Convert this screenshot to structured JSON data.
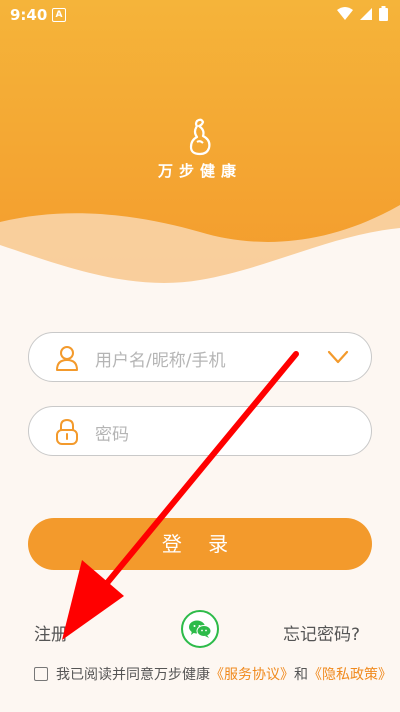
{
  "status": {
    "time": "9:40",
    "notif_letter": "A"
  },
  "app": {
    "name": "万步健康"
  },
  "form": {
    "username_placeholder": "用户名/昵称/手机",
    "password_placeholder": "密码",
    "login_label": "登 录"
  },
  "links": {
    "register": "注册",
    "forgot": "忘记密码?"
  },
  "agreement": {
    "text": "我已阅读并同意万步健康",
    "service": "《服务协议》",
    "and": "和",
    "privacy": "《隐私政策》"
  },
  "colors": {
    "accent": "#f39a2c",
    "link": "#f08a1e",
    "wechat": "#2dbb4a",
    "annotation": "#ff0000"
  },
  "icons": {
    "user": "user-icon",
    "lock": "lock-icon",
    "dropdown": "chevron-down-icon",
    "wechat": "wechat-icon"
  }
}
